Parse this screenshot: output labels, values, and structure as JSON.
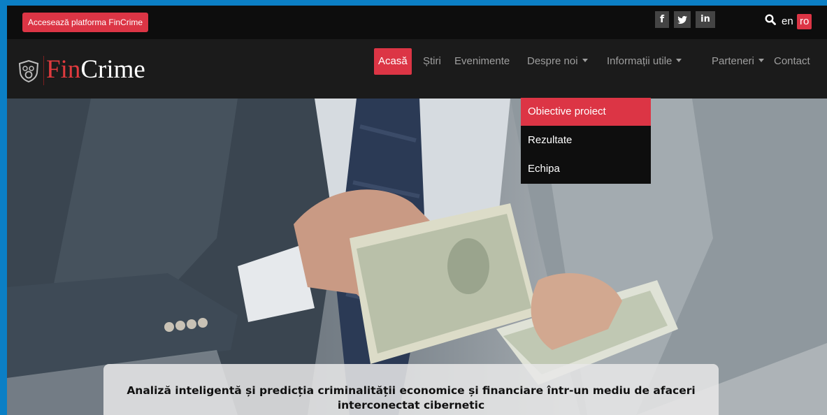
{
  "topbar": {
    "platform_button": "Accesează platforma FinCrime",
    "social": {
      "facebook": "f",
      "twitter": "🐦",
      "linkedin": "in"
    },
    "search_icon": "search-icon",
    "languages": [
      "en",
      "ro"
    ],
    "active_language": "ro"
  },
  "logo": {
    "part1": "Fin",
    "part2": "Crime",
    "shield_icon": "shield-crest-icon"
  },
  "nav": {
    "items": [
      {
        "label": "Acasă",
        "active": true,
        "dropdown": false
      },
      {
        "label": "Știri",
        "active": false,
        "dropdown": false
      },
      {
        "label": "Evenimente",
        "active": false,
        "dropdown": false
      },
      {
        "label": "Despre noi",
        "active": false,
        "dropdown": true
      },
      {
        "label": "Informații utile",
        "active": false,
        "dropdown": true
      },
      {
        "label": "Parteneri",
        "active": false,
        "dropdown": true
      },
      {
        "label": "Contact",
        "active": false,
        "dropdown": false
      }
    ]
  },
  "dropdown": {
    "items": [
      {
        "label": "Obiective proiect",
        "active": true
      },
      {
        "label": "Rezultate",
        "active": false
      },
      {
        "label": "Echipa",
        "active": false
      }
    ]
  },
  "hero": {
    "caption_line1": "Analiză inteligentă și predicția criminalității economice și financiare într-un mediu de afaceri",
    "caption_line2": "interconectat cibernetic"
  },
  "colors": {
    "accent": "#dc3545",
    "nav_bg": "#1b1b1b",
    "topbar_bg": "#0d0d0d",
    "frame": "#0b7fc5"
  }
}
